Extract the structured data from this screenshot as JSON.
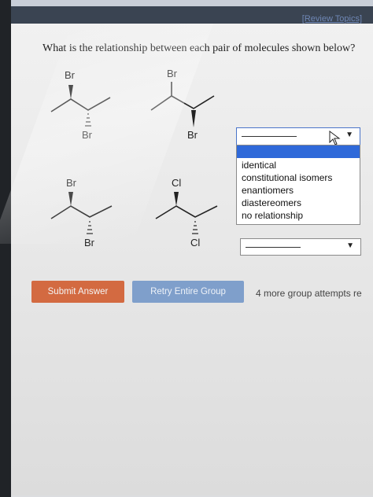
{
  "header": {
    "link": "[Review Topics]"
  },
  "question": "What is the relationship between each pair of molecules shown below?",
  "molecules": {
    "row1": {
      "left_top": "Br",
      "left_bottom": "Br",
      "right_top": "Br",
      "right_bottom": "Br"
    },
    "row2": {
      "left_top": "Br",
      "left_bottom": "Br",
      "right_top": "Cl",
      "right_bottom": "Cl"
    }
  },
  "select1": {
    "value": "",
    "options": [
      "identical",
      "constitutional isomers",
      "enantiomers",
      "diastereomers",
      "no relationship"
    ]
  },
  "select2": {
    "value": ""
  },
  "buttons": {
    "submit": "Submit Answer",
    "retry": "Retry Entire Group"
  },
  "attempts": "4 more group attempts re"
}
